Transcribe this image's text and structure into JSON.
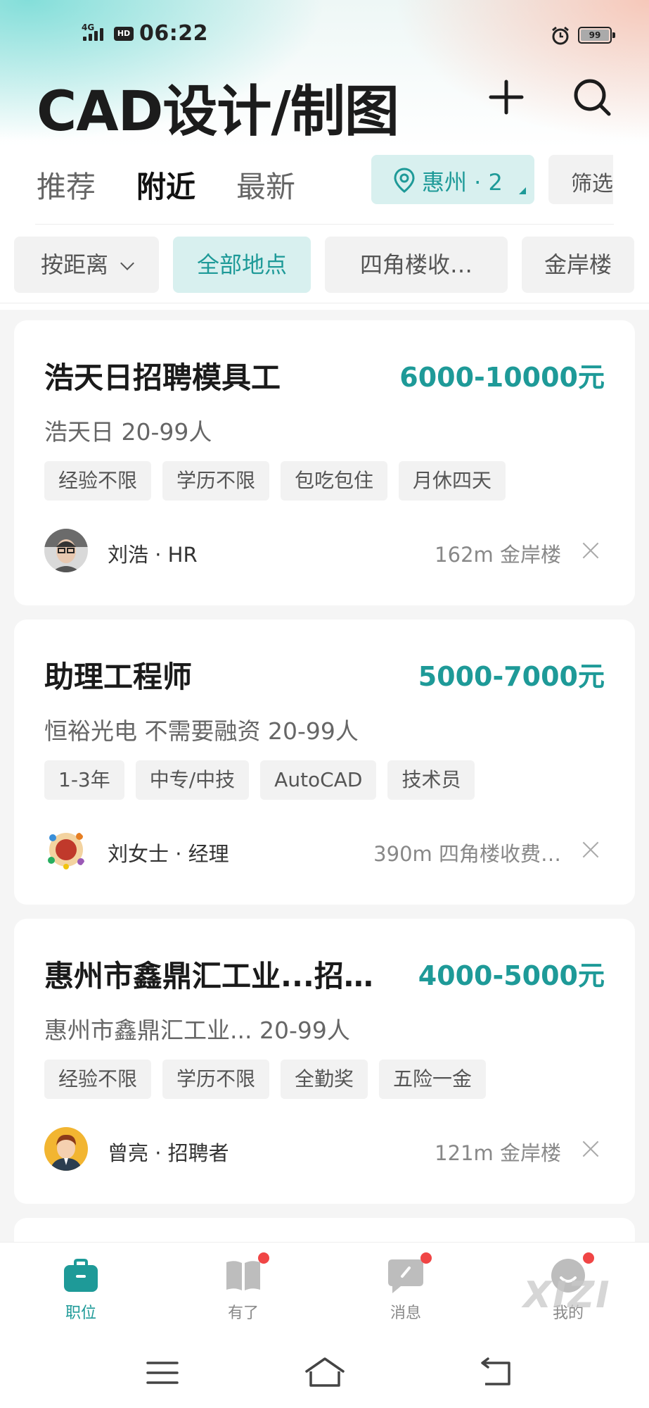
{
  "status_bar": {
    "network": "4G",
    "hd": "HD",
    "time": "06:22",
    "battery": "99"
  },
  "header": {
    "title": "CAD设计/制图"
  },
  "tabs": [
    {
      "label": "推荐",
      "active": false
    },
    {
      "label": "附近",
      "active": true
    },
    {
      "label": "最新",
      "active": false
    }
  ],
  "location": {
    "label": "惠州 · 2"
  },
  "filter": {
    "label": "筛选"
  },
  "chips": [
    {
      "label": "按距离",
      "active": false
    },
    {
      "label": "全部地点",
      "active": true
    },
    {
      "label": "四角楼收…",
      "active": false
    },
    {
      "label": "金岸楼",
      "active": false
    }
  ],
  "jobs": [
    {
      "title": "浩天日招聘模具工",
      "salary": "6000-10000元",
      "company": "浩天日  20-99人",
      "tags": [
        "经验不限",
        "学历不限",
        "包吃包住",
        "月休四天"
      ],
      "recruiter": "刘浩  ·  HR",
      "distance": "162m 金岸楼"
    },
    {
      "title": "助理工程师",
      "salary": "5000-7000元",
      "company": "恒裕光电  不需要融资  20-99人",
      "tags": [
        "1-3年",
        "中专/中技",
        "AutoCAD",
        "技术员"
      ],
      "recruiter": "刘女士  ·  经理",
      "distance": "390m 四角楼收费…"
    },
    {
      "title": "惠州市鑫鼎汇工业...招…",
      "salary": "4000-5000元",
      "company": "惠州市鑫鼎汇工业...  20-99人",
      "tags": [
        "经验不限",
        "学历不限",
        "全勤奖",
        "五险一金"
      ],
      "recruiter": "曾亮  ·  招聘者",
      "distance": "121m 金岸楼"
    }
  ],
  "bottom_nav": [
    {
      "label": "职位",
      "icon": "briefcase-icon",
      "active": true,
      "badge": false
    },
    {
      "label": "有了",
      "icon": "book-icon",
      "active": false,
      "badge": true
    },
    {
      "label": "消息",
      "icon": "chat-icon",
      "active": false,
      "badge": true
    },
    {
      "label": "我的",
      "icon": "profile-icon",
      "active": false,
      "badge": true
    }
  ],
  "watermark": "XIZI",
  "colors": {
    "accent": "#1e9a98",
    "badge": "#f04545",
    "background": "#f5f5f5"
  }
}
